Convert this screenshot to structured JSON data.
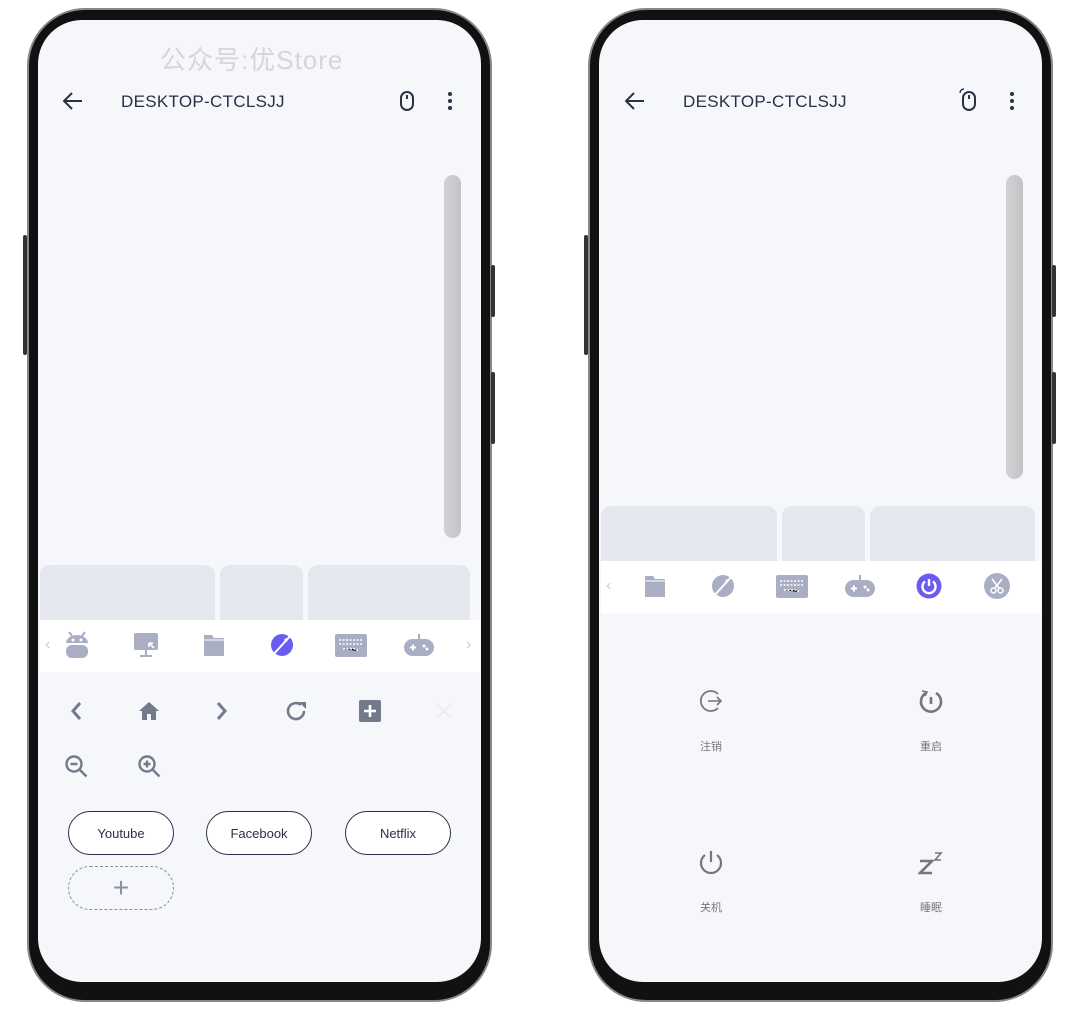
{
  "watermark": "公众号:优Store",
  "colors": {
    "accent": "#6b5cf0",
    "icon": "#a9aec5",
    "control": "#737a8c"
  },
  "left_phone": {
    "header": {
      "title": "DESKTOP-CTCLSJJ",
      "back_icon": "arrow-left-icon",
      "mouse_icon": "mouse-icon",
      "menu_icon": "more-vertical-icon"
    },
    "toolbar": {
      "icons": [
        "android-icon",
        "remote-desktop-icon",
        "folder-icon",
        "browser-planet-icon",
        "keyboard-icon",
        "gamepad-icon"
      ],
      "active": "browser-planet-icon"
    },
    "browser_controls": [
      "back",
      "home",
      "forward",
      "refresh",
      "new-tab",
      "close"
    ],
    "zoom_controls": [
      "zoom-out",
      "zoom-in"
    ],
    "bookmarks": [
      "Youtube",
      "Facebook",
      "Netflix"
    ],
    "add_bookmark": "+"
  },
  "right_phone": {
    "header": {
      "title": "DESKTOP-CTCLSJJ",
      "back_icon": "arrow-left-icon",
      "mouse_icon": "mouse-scroll-icon",
      "menu_icon": "more-vertical-icon"
    },
    "toolbar": {
      "icons": [
        "folder-icon",
        "browser-planet-icon",
        "keyboard-icon",
        "gamepad-icon",
        "power-icon",
        "scissors-icon"
      ],
      "active": "power-icon"
    },
    "power_actions": [
      {
        "label": "注销",
        "icon": "logout-icon"
      },
      {
        "label": "重启",
        "icon": "restart-icon"
      },
      {
        "label": "关机",
        "icon": "power-icon"
      },
      {
        "label": "睡眠",
        "icon": "sleep-icon"
      }
    ]
  }
}
